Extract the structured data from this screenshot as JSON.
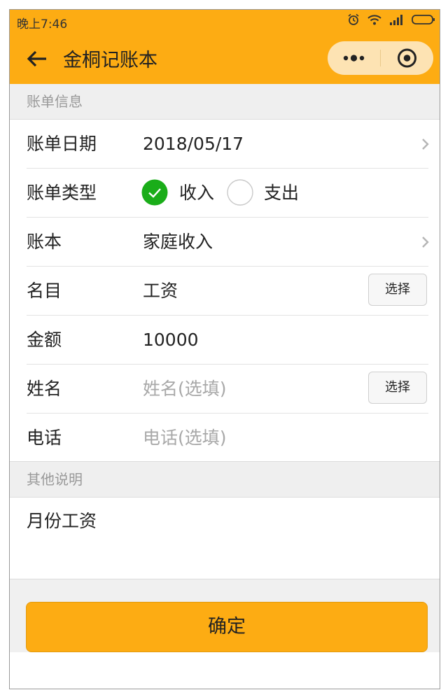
{
  "status_bar": {
    "time": "晚上7:46"
  },
  "nav": {
    "title": "金桐记账本"
  },
  "sections": {
    "bill_info": "账单信息",
    "other_notes": "其他说明"
  },
  "form": {
    "date": {
      "label": "账单日期",
      "value": "2018/05/17"
    },
    "type": {
      "label": "账单类型",
      "options": [
        "收入",
        "支出"
      ],
      "selected": "收入"
    },
    "book": {
      "label": "账本",
      "value": "家庭收入"
    },
    "item": {
      "label": "名目",
      "value": "工资",
      "button": "选择"
    },
    "amount": {
      "label": "金额",
      "value": "10000"
    },
    "name": {
      "label": "姓名",
      "placeholder": "姓名(选填)",
      "button": "选择"
    },
    "phone": {
      "label": "电话",
      "placeholder": "电话(选填)"
    }
  },
  "notes": {
    "text": "月份工资"
  },
  "confirm_label": "确定",
  "colors": {
    "brand": "#fdac13",
    "check": "#1aad19"
  }
}
